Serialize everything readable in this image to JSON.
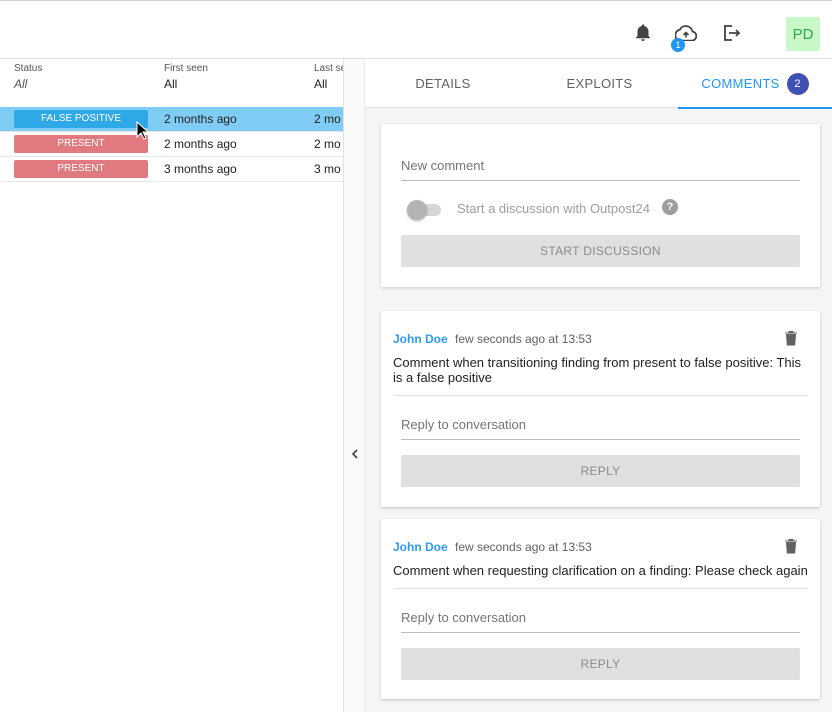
{
  "header": {
    "notification_badge": "1",
    "avatar_initials": "PD"
  },
  "table": {
    "columns": [
      {
        "label": "Status",
        "filter": "All"
      },
      {
        "label": "First seen",
        "filter": "All"
      },
      {
        "label": "Last se",
        "filter": "All"
      }
    ],
    "rows": [
      {
        "status": "FALSE POSITIVE",
        "first_seen": "2 months ago",
        "last_seen": "2 mo"
      },
      {
        "status": "PRESENT",
        "first_seen": "2 months ago",
        "last_seen": "2 mo"
      },
      {
        "status": "PRESENT",
        "first_seen": "3 months ago",
        "last_seen": "3 mo"
      }
    ]
  },
  "tabs": [
    {
      "label": "DETAILS"
    },
    {
      "label": "EXPLOITS"
    },
    {
      "label": "COMMENTS",
      "count": "2"
    }
  ],
  "new_comment": {
    "placeholder": "New comment",
    "toggle_label": "Start a discussion with Outpost24",
    "help_glyph": "?",
    "button": "START DISCUSSION"
  },
  "comments": [
    {
      "author": "John Doe",
      "time": "few seconds ago at 13:53",
      "text": "Comment when transitioning finding from present to false positive: This is a false positive",
      "reply_placeholder": "Reply to conversation",
      "reply_button": "REPLY"
    },
    {
      "author": "John Doe",
      "time": "few seconds ago at 13:53",
      "text": "Comment when requesting clarification on a finding: Please check again",
      "reply_placeholder": "Reply to conversation",
      "reply_button": "REPLY"
    }
  ],
  "colors": {
    "accent": "#2196f3",
    "false_positive": "#2fa8e8",
    "present": "#e07a80",
    "selected_row": "#7fcdf5"
  }
}
